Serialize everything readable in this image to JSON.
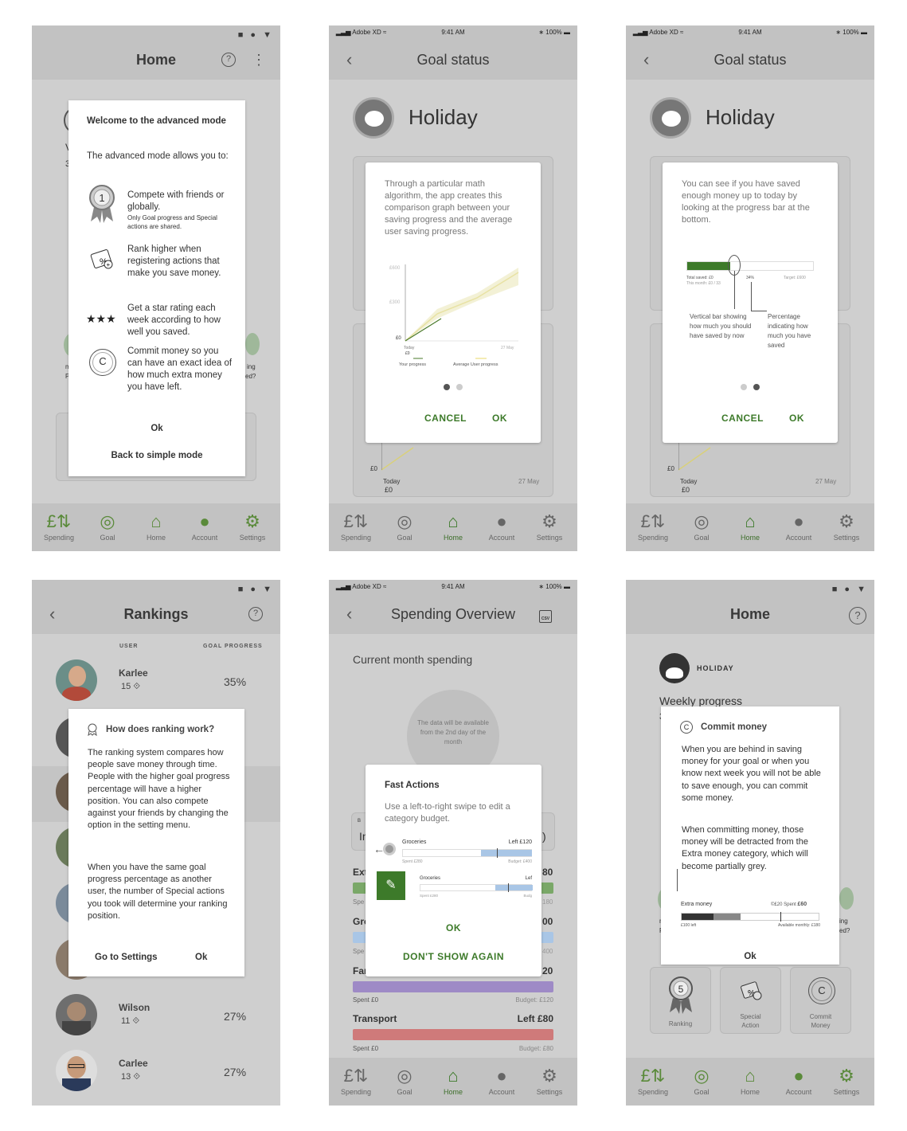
{
  "p1": {
    "title": "Home",
    "help": "?",
    "modal": {
      "heading": "Welcome to the advanced mode",
      "intro": "The advanced mode allows you to:",
      "items": [
        {
          "text": "Compete with friends or globally.",
          "note": "Only Goal progress and Special actions are shared.",
          "badge": "1"
        },
        {
          "text": "Rank higher when registering actions that make you save money."
        },
        {
          "text": "Get a star rating each week according to how well you saved.",
          "stars": "★★★"
        },
        {
          "text": "Commit money so you can have an exact idea of how much extra money you have left.",
          "badge": "C"
        }
      ],
      "ok": "Ok",
      "back": "Back to simple mode"
    },
    "bg_fragments": {
      "a": "V",
      "b": "3",
      "c": "m",
      "d": "P",
      "e": "ing",
      "f": "ed?"
    }
  },
  "nav": {
    "spending": "Spending",
    "goal": "Goal",
    "home": "Home",
    "account": "Account",
    "settings": "Settings"
  },
  "status": {
    "carrier": "Adobe XD",
    "time": "9:41 AM",
    "battery": "100%"
  },
  "p2": {
    "title": "Goal status",
    "goal_name": "Holiday",
    "modal_text": "Through a particular math algorithm, the app creates this comparison graph between your saving progress and the average user saving progress.",
    "chart": {
      "y_top": "£600",
      "y_mid": "£300",
      "y_bot": "£0",
      "x_left": "Today",
      "x_left2": "£0",
      "x_right": "27 May",
      "leg1": "Your progress",
      "leg2": "Average User progress"
    },
    "cancel": "CANCEL",
    "ok": "OK",
    "bg": {
      "y0": "£0",
      "today": "Today",
      "zero": "£0",
      "may": "27 May"
    }
  },
  "p3": {
    "title": "Goal status",
    "goal_name": "Holiday",
    "modal_text": "You can see if you have saved enough money up to today by looking at the progress bar at the bottom.",
    "progress": {
      "total": "Total saved: £0",
      "month": "This month: £0 / 33",
      "pct": "34%",
      "target": "Target: £600",
      "fraction": 0.34
    },
    "label_left": "Vertical bar showing how much you should have saved by now",
    "label_right": "Percentage indicating how much you have saved",
    "cancel": "CANCEL",
    "ok": "OK"
  },
  "p4": {
    "title": "Rankings",
    "col_user": "USER",
    "col_goal": "GOAL PROGRESS",
    "users": [
      {
        "name": "Karlee",
        "level": "15",
        "pct": "35%"
      },
      {
        "name": "Wilson",
        "level": "11",
        "pct": "27%"
      },
      {
        "name": "Carlee",
        "level": "13",
        "pct": "27%"
      }
    ],
    "modal": {
      "heading": "How does ranking work?",
      "p1": "The ranking system compares how people save money through time. People with the higher goal progress percentage will have a higher position. You can also compete against your friends by changing the option in the setting menu.",
      "p2": "When you have the same goal progress percentage as another user, the number of Special actions you took will determine your ranking position.",
      "settings": "Go to Settings",
      "ok": "Ok"
    }
  },
  "p5": {
    "title": "Spending Overview",
    "csv": "CSV",
    "section": "Current month spending",
    "circle_text": "The data will be available from the 2nd day of the month",
    "modal": {
      "heading": "Fast Actions",
      "text": "Use a left-to-right swipe to edit a category budget.",
      "g1_label": "Groceries",
      "g1_left": "Left £120",
      "g1_spent": "Spent £280",
      "g1_budget": "Budget: £400",
      "g2_label": "Groceries",
      "g2_left": "Lef",
      "g2_spent": "Spent £280",
      "g2_budget": "Budg",
      "ok": "OK",
      "dont": "DON'T SHOW AGAIN"
    },
    "bg": {
      "ext": "Ext",
      "ext_val": "80",
      "spe1": "Spe",
      "v180": "180",
      "gro": "Gro",
      "gro_val": "00",
      "spe2": "Spe",
      "v400": "400",
      "far": "Far",
      "far_val": "20",
      "fa_spent": "Spent £0",
      "fa_budget": "Budget: £120",
      "transport": "Transport",
      "tr_left": "Left  £80",
      "tr_spent": "Spent £0",
      "tr_budget": "Budget: £80",
      "b": "B",
      "I": "In",
      "paren": ")"
    },
    "colors": {
      "purple": "#9e8ac6",
      "red": "#cf7a7a",
      "blue": "#a9c6e6",
      "green": "#7aa868"
    }
  },
  "p6": {
    "title": "Home",
    "help": "?",
    "holiday": "HOLIDAY",
    "weekly": "Weekly progress",
    "modal": {
      "heading": "Commit money",
      "p1": "When you are behind in saving money for your goal or when you know next week you will not be able to save enough, you can commit some money.",
      "p2": "When committing money, those money will be detracted from the Extra money category, which will become partially grey.",
      "extra": "Extra money",
      "c20": "£20",
      "spent": "Spent",
      "spent_val": "£60",
      "left": "£100 left",
      "avail": "Available monthly: £180",
      "ok": "Ok"
    },
    "cards": [
      {
        "label": "Ranking",
        "badge": "5"
      },
      {
        "label": "Special Action"
      },
      {
        "label": "Commit Money",
        "badge": "C"
      }
    ],
    "bg": {
      "m": "m",
      "p": "P",
      "ing": "ing",
      "ed": "ed?",
      "three": "3"
    }
  }
}
